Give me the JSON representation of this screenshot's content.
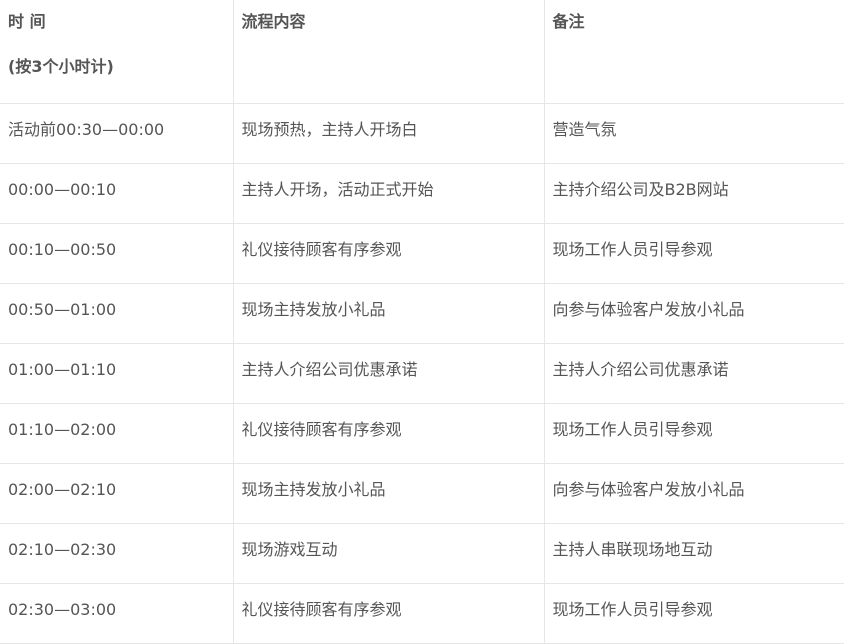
{
  "table": {
    "headers": {
      "time_line1": "时 间",
      "time_line2": "(按3个小时计)",
      "content": "流程内容",
      "remark": "备注"
    },
    "rows": [
      {
        "time": "活动前00:30—00:00",
        "content": "现场预热，主持人开场白",
        "remark": "营造气氛"
      },
      {
        "time": "00:00—00:10",
        "content": "主持人开场，活动正式开始",
        "remark": "主持介绍公司及B2B网站"
      },
      {
        "time": "00:10—00:50",
        "content": "礼仪接待顾客有序参观",
        "remark": "现场工作人员引导参观"
      },
      {
        "time": "00:50—01:00",
        "content": "现场主持发放小礼品",
        "remark": "向参与体验客户发放小礼品"
      },
      {
        "time": "01:00—01:10",
        "content": "主持人介绍公司优惠承诺",
        "remark": "主持人介绍公司优惠承诺"
      },
      {
        "time": "01:10—02:00",
        "content": "礼仪接待顾客有序参观",
        "remark": "现场工作人员引导参观"
      },
      {
        "time": "02:00—02:10",
        "content": "现场主持发放小礼品",
        "remark": "向参与体验客户发放小礼品"
      },
      {
        "time": "02:10—02:30",
        "content": "现场游戏互动",
        "remark": "主持人串联现场地互动"
      },
      {
        "time": "02:30—03:00",
        "content": "礼仪接待顾客有序参观",
        "remark": "现场工作人员引导参观"
      }
    ]
  }
}
